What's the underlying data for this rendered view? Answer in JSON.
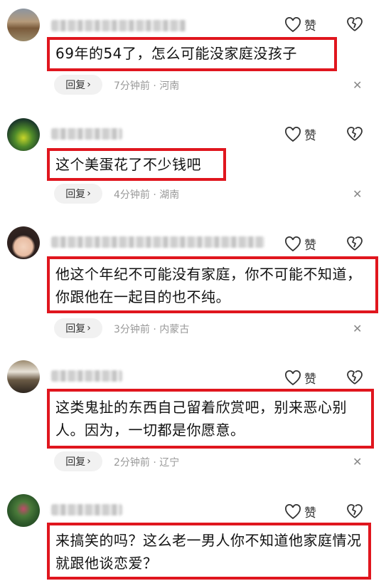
{
  "actions": {
    "like_label": "赞",
    "reply_label": "回复",
    "reply_chevron": "›"
  },
  "comments": [
    {
      "text": "69年的54了，怎么可能没家庭没孩子",
      "time": "7分钟前",
      "location": "河南"
    },
    {
      "text": "这个美蛋花了不少钱吧",
      "time": "4分钟前",
      "location": "湖南"
    },
    {
      "text": "他这个年纪不可能没有家庭，你不可能不知道，你跟他在一起目的也不纯。",
      "time": "3分钟前",
      "location": "内蒙古"
    },
    {
      "text": "这类鬼扯的东西自己留着欣赏吧，别来恶心别人。因为，一切都是你愿意。",
      "time": "2分钟前",
      "location": "辽宁"
    },
    {
      "text": "来搞笑的吗？这么老一男人你不知道他家庭情况就跟他谈恋爱？"
    }
  ],
  "meta_separator": "·",
  "close_glyph": "✕",
  "colors": {
    "highlight_border": "#e0161e",
    "meta_text": "#999999",
    "reply_bg": "#f1f1f1"
  }
}
